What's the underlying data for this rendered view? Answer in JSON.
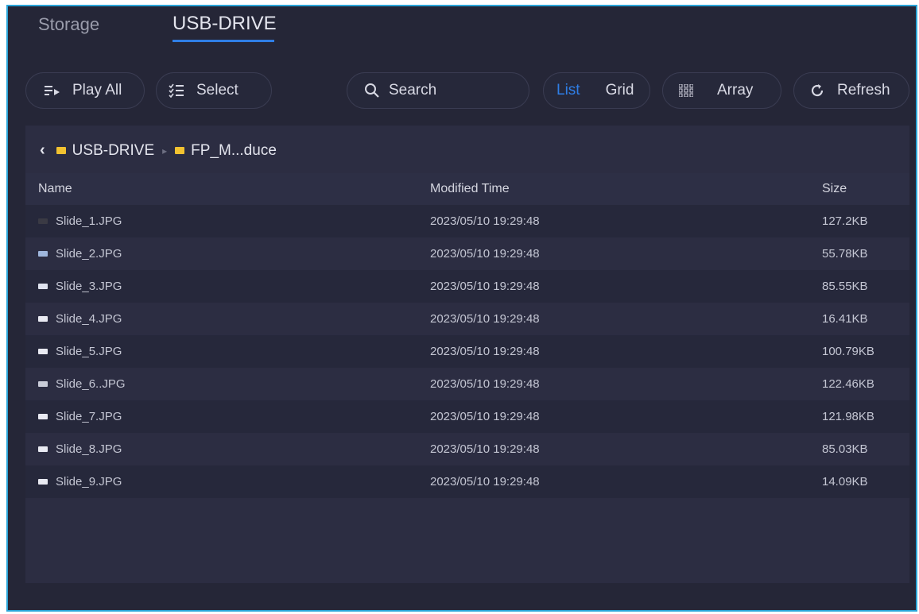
{
  "tabs": [
    {
      "label": "Storage",
      "active": false
    },
    {
      "label": "USB-DRIVE",
      "active": true
    }
  ],
  "toolbar": {
    "play_all": "Play All",
    "select": "Select",
    "search_placeholder": "Search",
    "view_list": "List",
    "view_grid": "Grid",
    "array": "Array",
    "refresh": "Refresh"
  },
  "breadcrumb": [
    "USB-DRIVE",
    "FP_M...duce"
  ],
  "table": {
    "columns": [
      "Name",
      "Modified Time",
      "Size"
    ],
    "rows": [
      {
        "name": "Slide_1.JPG",
        "time": "2023/05/10 19:29:48",
        "size": "127.2KB"
      },
      {
        "name": "Slide_2.JPG",
        "time": "2023/05/10 19:29:48",
        "size": "55.78KB"
      },
      {
        "name": "Slide_3.JPG",
        "time": "2023/05/10 19:29:48",
        "size": "85.55KB"
      },
      {
        "name": "Slide_4.JPG",
        "time": "2023/05/10 19:29:48",
        "size": "16.41KB"
      },
      {
        "name": "Slide_5.JPG",
        "time": "2023/05/10 19:29:48",
        "size": "100.79KB"
      },
      {
        "name": "Slide_6..JPG",
        "time": "2023/05/10 19:29:48",
        "size": "122.46KB"
      },
      {
        "name": "Slide_7.JPG",
        "time": "2023/05/10 19:29:48",
        "size": "121.98KB"
      },
      {
        "name": "Slide_8.JPG",
        "time": "2023/05/10 19:29:48",
        "size": "85.03KB"
      },
      {
        "name": "Slide_9.JPG",
        "time": "2023/05/10 19:29:48",
        "size": "14.09KB"
      }
    ]
  },
  "colors": {
    "background": "#252637",
    "accent": "#2f7ee6",
    "folder": "#f2c230",
    "frame_border": "#2aa5d8"
  },
  "icons": {
    "play_all": "playlist-play-icon",
    "select": "checklist-icon",
    "search": "search-icon",
    "array": "grid-array-icon",
    "refresh": "refresh-icon",
    "back": "chevron-left-icon",
    "folder": "folder-icon",
    "thumb": "image-thumbnail-icon"
  }
}
